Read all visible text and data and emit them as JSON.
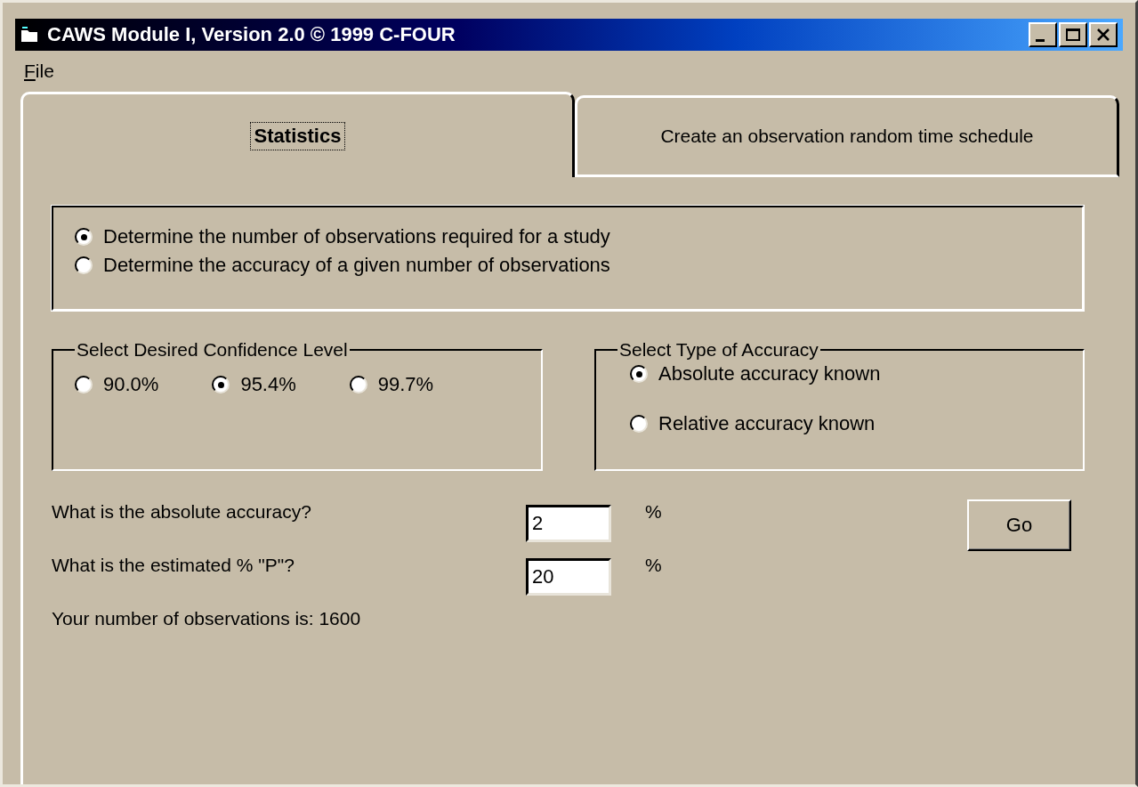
{
  "window": {
    "title": "CAWS Module I, Version 2.0 © 1999 C-FOUR"
  },
  "menu": [
    {
      "label": "File"
    }
  ],
  "tabs": [
    {
      "label": "Statistics",
      "selected": true
    },
    {
      "label": "Create an observation random time schedule",
      "selected": false
    }
  ],
  "mode_options": [
    {
      "label": "Determine the number of observations required for a study",
      "selected": true
    },
    {
      "label": "Determine the accuracy of a given number of observations",
      "selected": false
    }
  ],
  "confidence_group": {
    "title": "Select Desired Confidence Level",
    "options": [
      {
        "label": "90.0%",
        "selected": false
      },
      {
        "label": "95.4%",
        "selected": true
      },
      {
        "label": "99.7%",
        "selected": false
      }
    ]
  },
  "accuracy_group": {
    "title": "Select Type of Accuracy",
    "options": [
      {
        "label": "Absolute accuracy known",
        "selected": true
      },
      {
        "label": "Relative accuracy known",
        "selected": false
      }
    ]
  },
  "fields": [
    {
      "label": "What is the absolute accuracy?",
      "value": "2",
      "unit": "%"
    },
    {
      "label": "What is the estimated % \"P\"?",
      "value": "20",
      "unit": "%"
    }
  ],
  "result": "Your number of observations is: 1600",
  "go_button": "Go"
}
